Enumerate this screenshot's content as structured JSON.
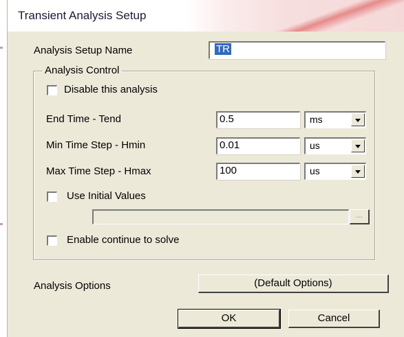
{
  "dialog": {
    "title": "Transient Analysis Setup"
  },
  "setup_name": {
    "label": "Analysis Setup Name",
    "value": "TR"
  },
  "analysis_control": {
    "group_label": "Analysis Control",
    "disable_label": "Disable this analysis",
    "disable_checked": false,
    "end_time": {
      "label": "End Time - Tend",
      "value": "0.5",
      "unit": "ms"
    },
    "min_step": {
      "label": "Min Time Step - Hmin",
      "value": "0.01",
      "unit": "us"
    },
    "max_step": {
      "label": "Max Time Step - Hmax",
      "value": "100",
      "unit": "us"
    },
    "initial_values_label": "Use Initial Values",
    "initial_values_checked": false,
    "initial_values_path": "",
    "browse_label": "...",
    "continue_label": "Enable continue to solve",
    "continue_checked": false
  },
  "options": {
    "label": "Analysis Options",
    "button_label": "(Default Options)"
  },
  "buttons": {
    "ok": "OK",
    "cancel": "Cancel"
  },
  "icons": {
    "combo_arrow": "chevron-down-icon"
  },
  "colors": {
    "dialog_background": "#ece9d8",
    "selection": "#316ac5"
  }
}
